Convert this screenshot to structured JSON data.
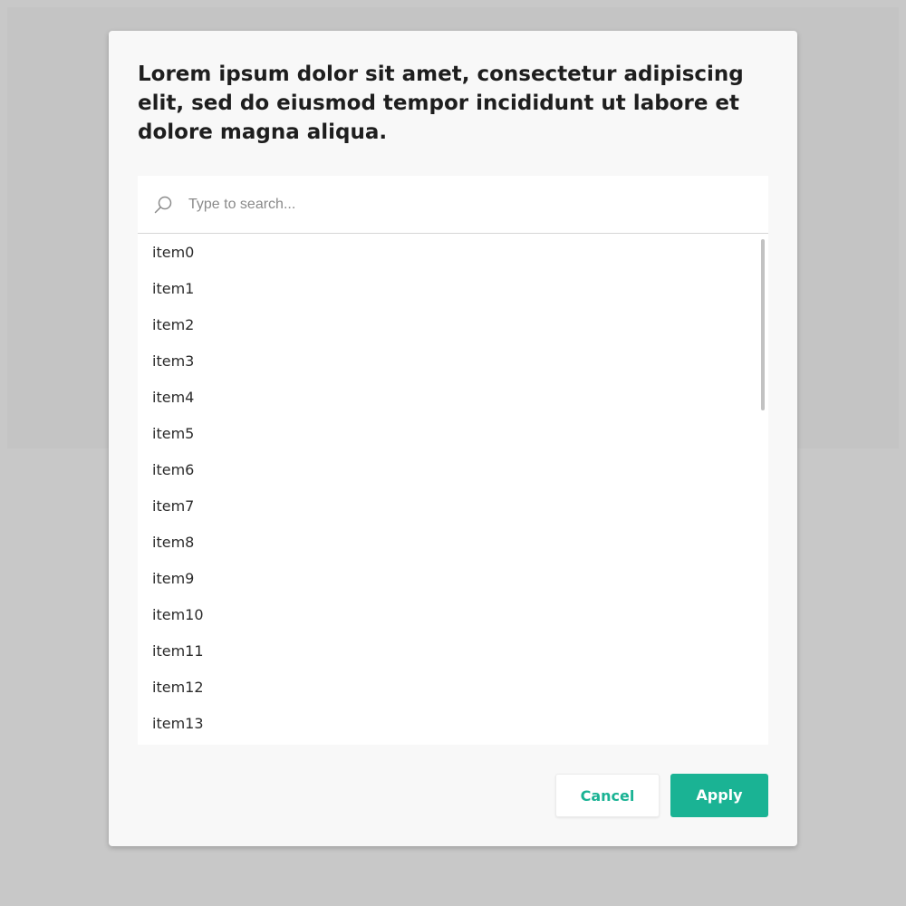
{
  "dialog": {
    "title": "Lorem ipsum dolor sit amet, consectetur adipiscing elit, sed do eiusmod tempor incididunt ut labore et dolore magna aliqua."
  },
  "search": {
    "placeholder": "Type to search...",
    "value": "",
    "icon": "search-icon"
  },
  "list": {
    "items": [
      "item0",
      "item1",
      "item2",
      "item3",
      "item4",
      "item5",
      "item6",
      "item7",
      "item8",
      "item9",
      "item10",
      "item11",
      "item12",
      "item13"
    ]
  },
  "actions": {
    "cancel_label": "Cancel",
    "apply_label": "Apply"
  },
  "colors": {
    "accent": "#1ab394",
    "overlay": "#c8c8c8",
    "dialog_background": "#f8f8f8"
  }
}
